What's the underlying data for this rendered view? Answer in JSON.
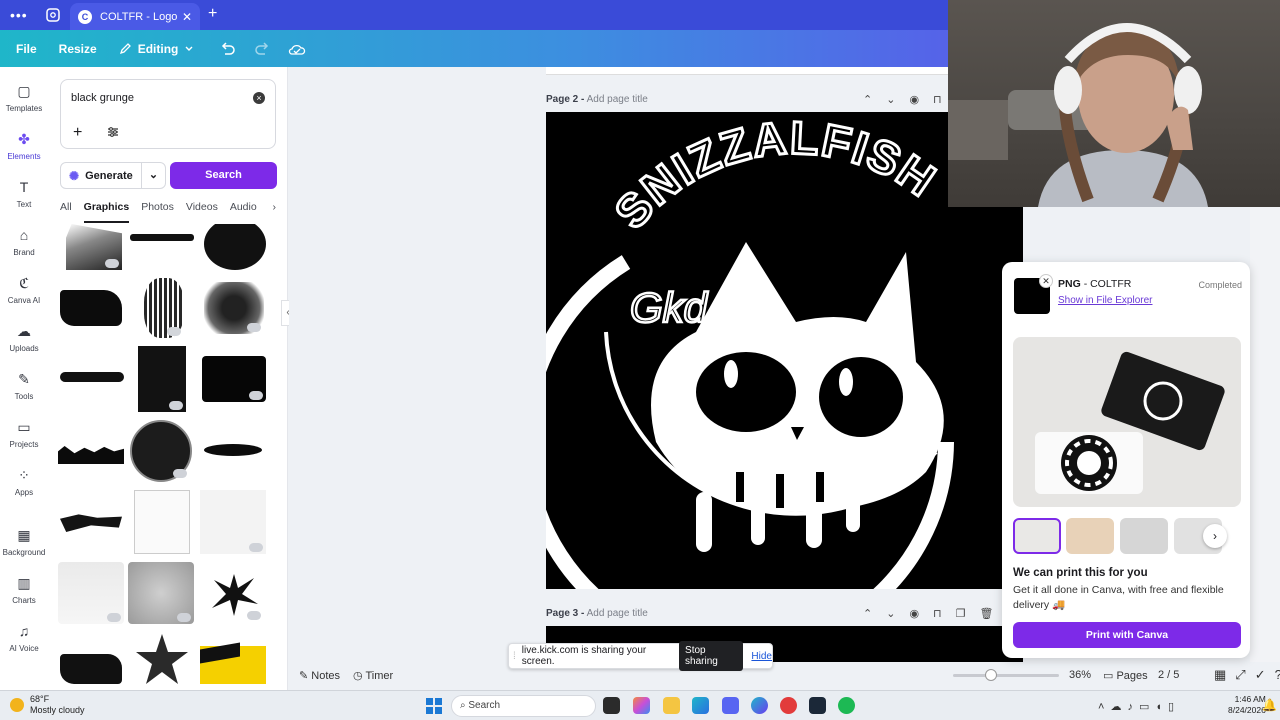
{
  "browser": {
    "tab_title": "COLTFR - Logo",
    "tab_favicon_letter": "C",
    "menu_dots": "•••",
    "new_tab": "+",
    "close_tab": "✕"
  },
  "toolbar": {
    "file": "File",
    "resize": "Resize",
    "editing": "Editing",
    "undo_icon": "undo-icon",
    "redo_icon": "redo-icon",
    "cloud_icon": "cloud-saved-icon"
  },
  "rail": {
    "items": [
      {
        "label": "Templates",
        "icon": "templates-icon"
      },
      {
        "label": "Elements",
        "icon": "elements-icon"
      },
      {
        "label": "Text",
        "icon": "text-icon"
      },
      {
        "label": "Brand",
        "icon": "brand-icon"
      },
      {
        "label": "Canva AI",
        "icon": "canva-ai-icon"
      },
      {
        "label": "Uploads",
        "icon": "uploads-icon"
      },
      {
        "label": "Tools",
        "icon": "tools-icon"
      },
      {
        "label": "Projects",
        "icon": "projects-icon"
      },
      {
        "label": "Apps",
        "icon": "apps-icon"
      },
      {
        "label": "Background",
        "icon": "background-icon"
      },
      {
        "label": "Charts",
        "icon": "charts-icon"
      },
      {
        "label": "AI Voice",
        "icon": "ai-voice-icon"
      }
    ],
    "active": "Elements"
  },
  "panel": {
    "search_value": "black grunge",
    "generate_label": "Generate",
    "search_button": "Search",
    "tabs": [
      "All",
      "Graphics",
      "Photos",
      "Videos",
      "Audio"
    ],
    "active_tab": "Graphics"
  },
  "canvas": {
    "page2_label": "Page 2 -",
    "page2_sub": "Add page title",
    "page3_label": "Page 3 -",
    "page3_sub": "Add page title",
    "design_text": "SNIZZALFISH",
    "tag_text": "Gkd"
  },
  "bottombar": {
    "notes": "Notes",
    "timer": "Timer",
    "zoom": "36%",
    "zoom_fraction": 0.36,
    "pages": "Pages",
    "page_count": "2 / 5"
  },
  "share_bar": {
    "message": "live.kick.com is sharing your screen.",
    "stop": "Stop sharing",
    "hide": "Hide"
  },
  "popup": {
    "file_type": "PNG",
    "file_name": "- COLTFR",
    "link": "Show in File Explorer",
    "status": "Completed",
    "heading": "We can print this for you",
    "description": "Get it all done in Canva, with free and flexible delivery 🚚",
    "print_button": "Print with Canva"
  },
  "taskbar": {
    "temp": "68°F",
    "weather": "Mostly cloudy",
    "search": "Search",
    "time": "1:46 AM",
    "date": "8/24/2026"
  },
  "colors": {
    "accent_purple": "#7d2ae8",
    "toolbar_start": "#1fb6c9",
    "toolbar_end": "#6b3cf0"
  }
}
